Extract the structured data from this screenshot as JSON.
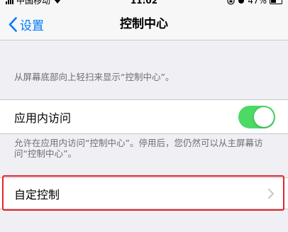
{
  "status_bar": {
    "carrier": "中国移动",
    "time": "11:02",
    "battery_text": "47%"
  },
  "nav": {
    "back_label": "设置",
    "title": "控制中心"
  },
  "top_footnote": "从屏幕底部向上轻扫来显示“控制中心”。",
  "access_within_apps": {
    "label": "应用内访问",
    "toggle_on": true,
    "toggle_color": "#4cd964"
  },
  "access_footnote": "允许在应用内访问“控制中心”。停用后，您仍然可以从主屏幕访问“控制中心”。",
  "customize": {
    "label": "自定控制"
  },
  "colors": {
    "accent": "#007aff",
    "highlight": "#e8242a",
    "background": "#efeff4"
  }
}
